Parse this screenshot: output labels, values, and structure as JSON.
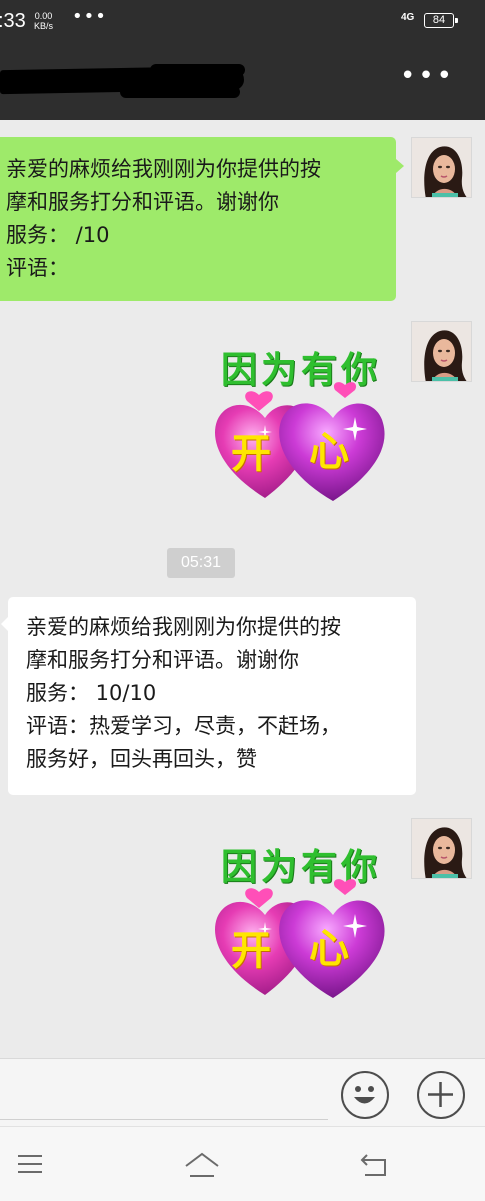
{
  "status_bar": {
    "time": ":33",
    "net_speed_value": "0.00",
    "net_speed_unit": "KB/s",
    "overflow_dots": "•••",
    "network": "4G",
    "battery": "84"
  },
  "title_bar": {
    "title_redacted": true,
    "more_label": "•••"
  },
  "messages": [
    {
      "type": "text",
      "sender": "self",
      "bubble_color": "#9eea6a",
      "lines": [
        "亲爱的麻烦给我刚刚为你提供的按",
        "摩和服务打分和评语。谢谢你",
        "服务：  /10",
        "评语："
      ]
    },
    {
      "type": "sticker",
      "sender": "self",
      "caption": "因为有你",
      "heart_left_text": "开",
      "heart_right_text": "心"
    },
    {
      "type": "timestamp",
      "text": "05:31"
    },
    {
      "type": "text",
      "sender": "other",
      "bubble_color": "#ffffff",
      "lines": [
        "亲爱的麻烦给我刚刚为你提供的按",
        "摩和服务打分和评语。谢谢你",
        "服务：  10/10",
        "评语：热爱学习，尽责，不赶场，",
        "服务好，回头再回头，赞"
      ]
    },
    {
      "type": "sticker",
      "sender": "self",
      "caption": "因为有你",
      "heart_left_text": "开",
      "heart_right_text": "心"
    }
  ],
  "input_bar": {
    "emoji_icon": "smiley-icon",
    "plus_icon": "plus-icon"
  },
  "nav_bar": {
    "menu_icon": "menu-icon",
    "home_icon": "home-icon",
    "back_icon": "back-icon"
  },
  "colors": {
    "header_bg": "#2e2e2e",
    "chat_bg": "#ebebeb",
    "self_bubble": "#9eea6a",
    "other_bubble": "#ffffff",
    "heart_pink": "#e63cb4",
    "sticker_text_green": "#2fbf2f"
  }
}
